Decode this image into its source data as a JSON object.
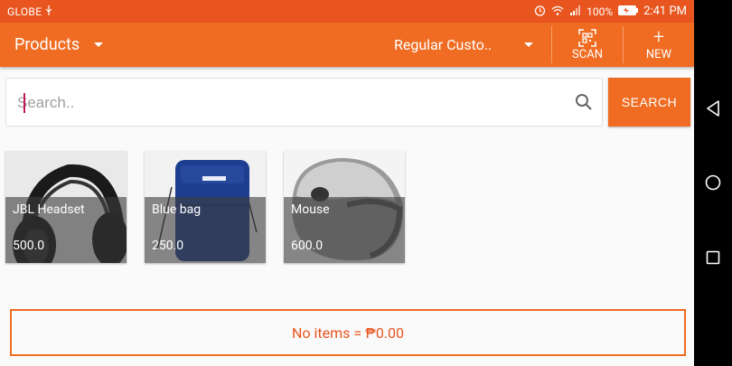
{
  "status_bar": {
    "carrier": "GLOBE",
    "battery": "100%",
    "time": "2:41 PM"
  },
  "toolbar": {
    "title": "Products",
    "customer": "Regular Custo..",
    "scan_label": "SCAN",
    "new_label": "NEW"
  },
  "search": {
    "placeholder": "Search..",
    "button_label": "SEARCH"
  },
  "products": [
    {
      "name": "JBL Headset",
      "price": "500.0"
    },
    {
      "name": "Blue bag",
      "price": "250.0"
    },
    {
      "name": "Mouse",
      "price": "600.0"
    }
  ],
  "summary": {
    "total_text": "No items = ₱0.00"
  },
  "colors": {
    "status_bar": "#e8551f",
    "toolbar": "#ef6c22",
    "accent": "#ef6c22"
  }
}
